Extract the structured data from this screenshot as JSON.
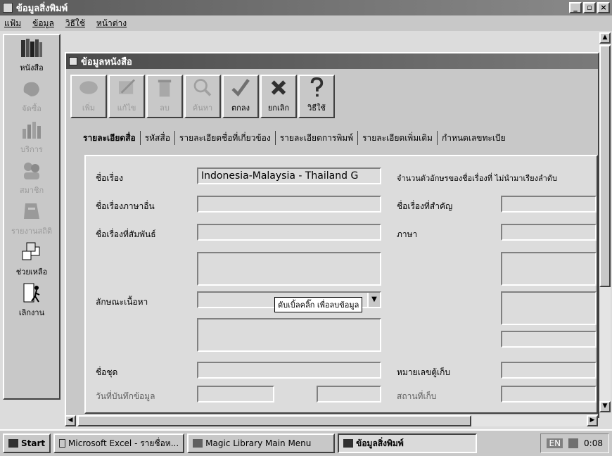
{
  "window": {
    "title": "ข้อมูลสิ่งพิมพ์",
    "min": "_",
    "max": "▫",
    "close": "×"
  },
  "menu": [
    "แฟ้ม",
    "ข้อมูล",
    "วิธีใช้",
    "หน้าต่าง"
  ],
  "sidebar": [
    {
      "label": "หนังสือ",
      "icon": "books-icon",
      "enabled": true
    },
    {
      "label": "จัดซื้อ",
      "icon": "purchase-icon",
      "enabled": false
    },
    {
      "label": "บริการ",
      "icon": "chart-icon",
      "enabled": false
    },
    {
      "label": "สมาชิก",
      "icon": "members-icon",
      "enabled": false
    },
    {
      "label": "รายงานสถิติ",
      "icon": "report-icon",
      "enabled": false
    },
    {
      "label": "ช่วยเหลือ",
      "icon": "help-cubes-icon",
      "enabled": true
    },
    {
      "label": "เลิกงาน",
      "icon": "exit-door-icon",
      "enabled": true
    }
  ],
  "child": {
    "title": "ข้อมูลหนังสือ"
  },
  "toolbar": [
    {
      "label": "เพิ่ม",
      "icon": "add-icon",
      "enabled": false
    },
    {
      "label": "แก้ไข",
      "icon": "edit-icon",
      "enabled": false
    },
    {
      "label": "ลบ",
      "icon": "delete-icon",
      "enabled": false
    },
    {
      "label": "ค้นหา",
      "icon": "search-icon",
      "enabled": false
    },
    {
      "label": "ตกลง",
      "icon": "check-icon",
      "enabled": true
    },
    {
      "label": "ยกเลิก",
      "icon": "cancel-icon",
      "enabled": true
    },
    {
      "label": "วิธีใช้",
      "icon": "question-icon",
      "enabled": true
    }
  ],
  "tabs": [
    "รายละเอียดสื่อ",
    "รหัสสื่อ",
    "รายละเอียดชื่อที่เกี่ยวข้อง",
    "รายละเอียดการพิมพ์",
    "รายละเอียดเพิ่มเติม",
    "กำหนดเลขทะเบีย"
  ],
  "form": {
    "title_label": "ชื่อเรื่อง",
    "title_value": "Indonesia-Malaysia - Thailand G",
    "other_lang_title_label": "ชื่อเรื่องภาษาอื่น",
    "related_title_label": "ชื่อเรื่องที่สัมพันธ์",
    "content_label": "ลักษณะเนื้อหา",
    "series_label": "ชื่อชุด",
    "bottom_left_label": "วันที่บันทึกข้อมูล",
    "char_count_label": "จำนวนตัวอักษรของชื่อเรื่องที่ ไม่นำมาเรียงลำดับ",
    "key_title_label": "ชื่อเรื่องที่สำคัญ",
    "language_label": "ภาษา",
    "shelf_label": "หมายเลขตู้เก็บ",
    "storage_label": "สถานที่เก็บ",
    "dropdown_arrow": "▼"
  },
  "tooltip": "ดับเบิ้ลคลิ๊ก เพื่อลบข้อมูล",
  "taskbar": {
    "start": "Start",
    "items": [
      "Microsoft Excel - รายชื่อห...",
      "Magic Library Main Menu",
      "ข้อมูลสิ่งพิมพ์"
    ],
    "lang": "EN",
    "clock": "0:08"
  }
}
